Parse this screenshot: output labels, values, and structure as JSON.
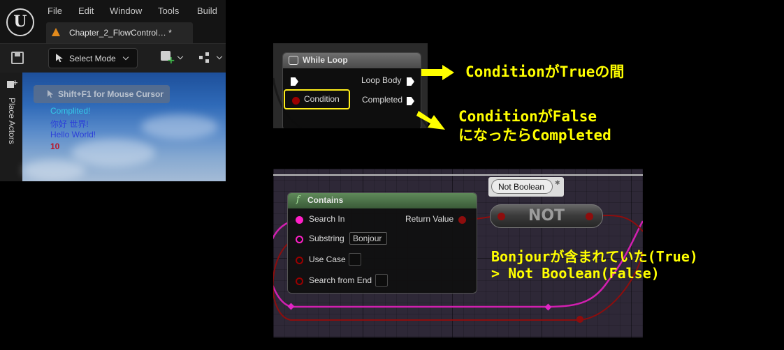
{
  "editor": {
    "logo": "U",
    "menu": [
      "File",
      "Edit",
      "Window",
      "Tools",
      "Build"
    ],
    "tab": {
      "label": "Chapter_2_FlowControl… *"
    },
    "toolbar": {
      "select_mode": "Select Mode"
    },
    "sidebar": {
      "label": "Place Actors"
    },
    "viewport": {
      "hint": "Shift+F1 for Mouse Cursor",
      "log_lines": [
        {
          "text": "Complited!",
          "color": "#35c9e8"
        },
        {
          "text": "你好 世界!",
          "color": "#2d41d8"
        },
        {
          "text": "Hello World!",
          "color": "#2d41d8"
        },
        {
          "text": "10",
          "color": "#b8152a"
        }
      ]
    }
  },
  "while_loop": {
    "title": "While Loop",
    "pins": {
      "condition": "Condition",
      "loop_body": "Loop Body",
      "completed": "Completed"
    }
  },
  "notes": {
    "loop_body": "ConditionがTrueの間",
    "completed_line1": "ConditionがFalse",
    "completed_line2": "になったらCompleted",
    "result_line1": "Bonjourが含まれていた(True)",
    "result_line2": "> Not Boolean(False)"
  },
  "contains_node": {
    "icon": "f",
    "title": "Contains",
    "pins": {
      "search_in": "Search In",
      "return_value": "Return Value",
      "substring": "Substring",
      "substring_value": "Bonjour",
      "use_case": "Use Case",
      "search_from_end": "Search from End"
    }
  },
  "not_node": {
    "label": "NOT",
    "tooltip": "Not Boolean"
  },
  "colors": {
    "annotation": "#ffff00",
    "condition_highlight": "#ffee1a",
    "string_pin": "#ff1fc7",
    "bool_pin": "#9a0000",
    "function_header": "#5f8a5a"
  }
}
